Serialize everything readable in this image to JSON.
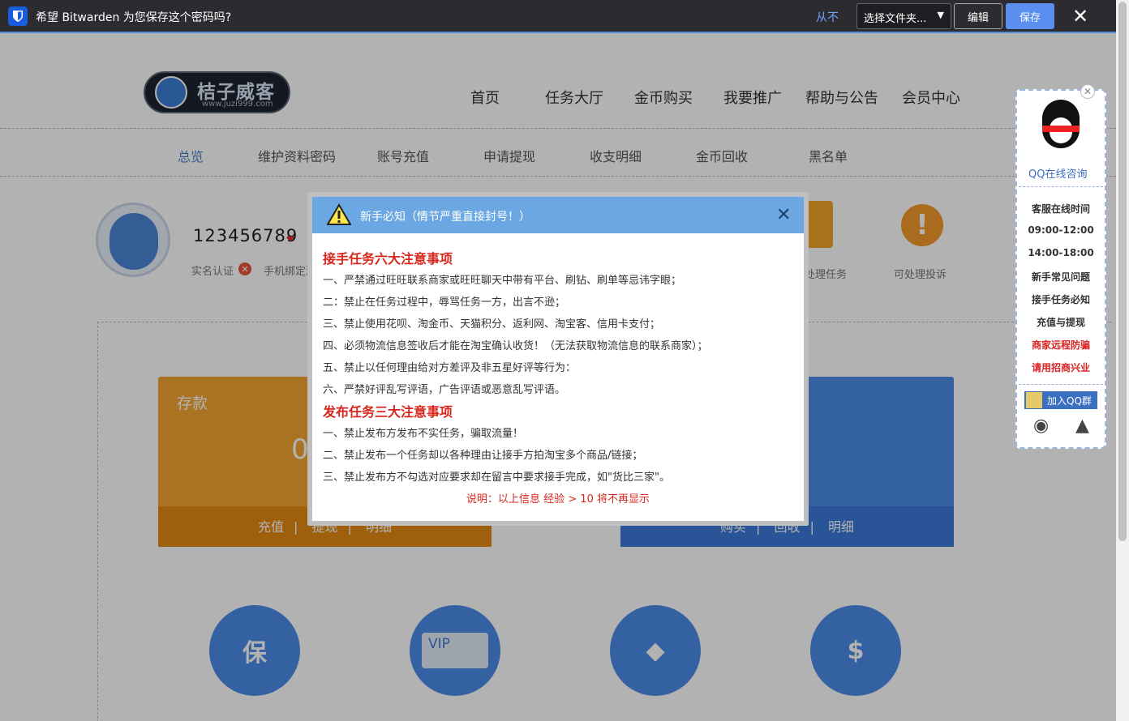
{
  "bitwarden": {
    "message": "希望 Bitwarden 为您保存这个密码吗?",
    "never": "从不",
    "folder_select": "选择文件夹...",
    "edit": "编辑",
    "save": "保存"
  },
  "site": {
    "logo_name": "桔子威客",
    "logo_url": "www.juzi999.com",
    "nav": [
      "首页",
      "任务大厅",
      "金币购买",
      "我要推广",
      "帮助与公告",
      "会员中心"
    ],
    "subnav": [
      "总览",
      "维护资料密码",
      "账号充值",
      "申请提现",
      "收支明细",
      "金币回收",
      "黑名单"
    ]
  },
  "profile": {
    "username": "123456789",
    "realname": "实名认证",
    "phone": "手机绑定激",
    "task_label": "处理任务",
    "complaint_label": "可处理投诉"
  },
  "cards": {
    "deposit_title": "存款",
    "deposit_amount": "0",
    "deposit_links": [
      "充值",
      "提现",
      "明细"
    ],
    "gold_links": [
      "购买",
      "回收",
      "明细"
    ]
  },
  "features": {
    "shield_text": "保",
    "vip_text": "VIP"
  },
  "qq_panel": {
    "consult": "QQ在线咨询",
    "items": [
      "客服在线时间",
      "09:00-12:00",
      "14:00-18:00",
      "新手常见问题",
      "接手任务必知",
      "充值与提现",
      "商家远程防骗",
      "请用招商兴业"
    ],
    "join_group": "加入QQ群"
  },
  "modal": {
    "title": "新手必知（情节严重直接封号！）",
    "section1_title": "接手任务六大注意事项",
    "section1_rules": [
      "一、严禁通过旺旺联系商家或旺旺聊天中带有平台、刷钻、刷单等忌讳字眼；",
      "二：禁止在任务过程中，辱骂任务一方，出言不逊；",
      "三、禁止使用花呗、淘金币、天猫积分、返利网、淘宝客、信用卡支付；",
      "四、必须物流信息签收后才能在淘宝确认收货！（无法获取物流信息的联系商家）；",
      "五、禁止以任何理由给对方差评及非五星好评等行为：",
      "六、严禁好评乱写评语，广告评语或恶意乱写评语。"
    ],
    "section2_title": "发布任务三大注意事项",
    "section2_rules": [
      "一、禁止发布方发布不实任务，骗取流量！",
      "二、禁止发布一个任务却以各种理由让接手方拍淘宝多个商品/链接；",
      "三、禁止发布方不勾选对应要求却在留言中要求接手完成，如\"货比三家\"。"
    ],
    "note": "说明：以上信息 经验 > 10 将不再显示"
  }
}
